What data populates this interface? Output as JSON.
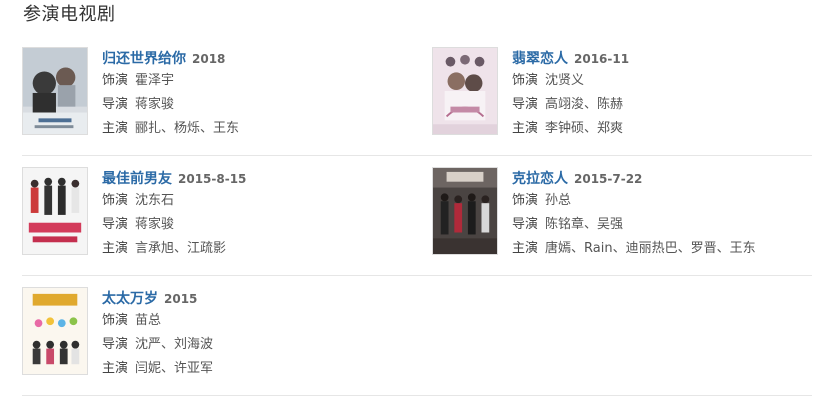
{
  "section": {
    "title": "参演电视剧"
  },
  "labels": {
    "role": "饰演",
    "director": "导演",
    "cast": "主演"
  },
  "shows": [
    {
      "title": "归还世界给你",
      "year": "2018",
      "role": "霍泽宇",
      "director": "蒋家骏",
      "cast": "郦扎、杨烁、王东"
    },
    {
      "title": "翡翠恋人",
      "year": "2016-11",
      "role": "沈贤义",
      "director": "高翊浚、陈赫",
      "cast": "李钟硕、郑爽"
    },
    {
      "title": "最佳前男友",
      "year": "2015-8-15",
      "role": "沈东石",
      "director": "蒋家骏",
      "cast": "言承旭、江疏影"
    },
    {
      "title": "克拉恋人",
      "year": "2015-7-22",
      "role": "孙总",
      "director": "陈铭章、吴强",
      "cast": "唐嫣、Rain、迪丽热巴、罗晋、王东"
    },
    {
      "title": "太太万岁",
      "year": "2015",
      "role": "苗总",
      "director": "沈严、刘海波",
      "cast": "闫妮、许亚军"
    }
  ],
  "colors": {
    "link": "#2b6aa6",
    "divider": "#e6e6e6",
    "text": "#555555"
  }
}
